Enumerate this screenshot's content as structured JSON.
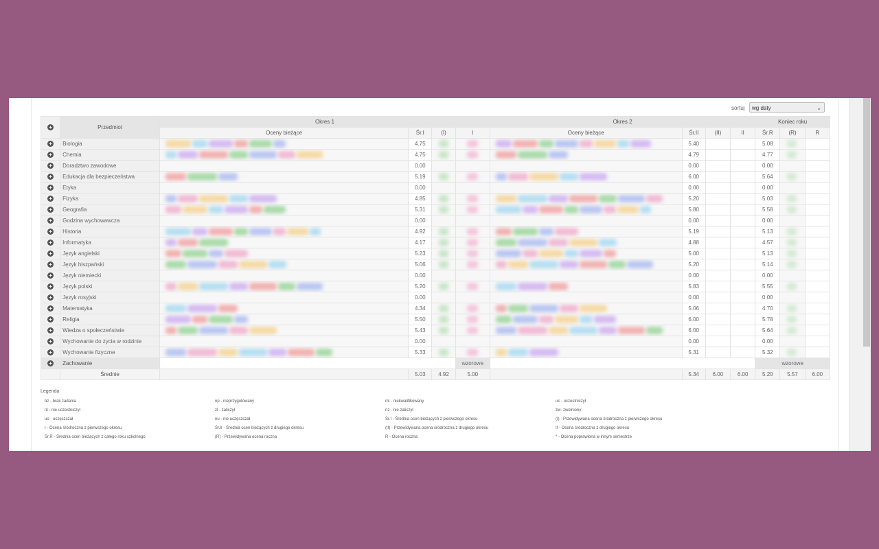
{
  "sort": {
    "label": "sortuj",
    "value": "wg daty"
  },
  "headers": {
    "subject": "Przedmiot",
    "period1": "Okres 1",
    "period2": "Okres 2",
    "year_end": "Koniec roku",
    "current1": "Oceny bieżące",
    "current2": "Oceny bieżące",
    "avg1": "Śr.I",
    "pred1": "(I)",
    "final1": "I",
    "avg2": "Śr.II",
    "pred2": "(II)",
    "final2": "II",
    "avgR": "Śr.R",
    "predR": "(R)",
    "finalR": "R"
  },
  "subjects": [
    {
      "name": "Biologia",
      "avg1": "4.75",
      "avg2": "5.40",
      "avgR": "5.08"
    },
    {
      "name": "Chemia",
      "avg1": "4.75",
      "avg2": "4.79",
      "avgR": "4.77"
    },
    {
      "name": "Doradztwo zawodowe",
      "avg1": "0.00",
      "avg2": "0.00",
      "avgR": "0.00"
    },
    {
      "name": "Edukacja dla bezpieczeństwa",
      "avg1": "5.19",
      "avg2": "6.00",
      "avgR": "5.64"
    },
    {
      "name": "Etyka",
      "avg1": "0.00",
      "avg2": "0.00",
      "avgR": "0.00"
    },
    {
      "name": "Fizyka",
      "avg1": "4.85",
      "avg2": "5.20",
      "avgR": "5.03"
    },
    {
      "name": "Geografia",
      "avg1": "5.31",
      "avg2": "5.80",
      "avgR": "5.58"
    },
    {
      "name": "Godzina wychowawcza",
      "avg1": "0.00",
      "avg2": "0.00",
      "avgR": "0.00"
    },
    {
      "name": "Historia",
      "avg1": "4.92",
      "avg2": "5.19",
      "avgR": "5.13"
    },
    {
      "name": "Informatyka",
      "avg1": "4.17",
      "avg2": "4.88",
      "avgR": "4.57"
    },
    {
      "name": "Język angielski",
      "avg1": "5.23",
      "avg2": "5.00",
      "avgR": "5.13"
    },
    {
      "name": "Język hiszpański",
      "avg1": "5.06",
      "avg2": "5.20",
      "avgR": "5.14"
    },
    {
      "name": "Język niemiecki",
      "avg1": "0.00",
      "avg2": "0.00",
      "avgR": "0.00"
    },
    {
      "name": "Język polski",
      "avg1": "5.20",
      "avg2": "5.83",
      "avgR": "5.55"
    },
    {
      "name": "Język rosyjski",
      "avg1": "0.00",
      "avg2": "0.00",
      "avgR": "0.00"
    },
    {
      "name": "Matematyka",
      "avg1": "4.34",
      "avg2": "5.06",
      "avgR": "4.70"
    },
    {
      "name": "Religia",
      "avg1": "5.50",
      "avg2": "6.00",
      "avgR": "5.78"
    },
    {
      "name": "Wiedza o społeczeństwie",
      "avg1": "5.43",
      "avg2": "6.00",
      "avgR": "5.64"
    },
    {
      "name": "Wychowanie do życia w rodzinie",
      "avg1": "0.00",
      "avg2": "0.00",
      "avgR": "0.00"
    },
    {
      "name": "Wychowanie fizyczne",
      "avg1": "5.33",
      "avg2": "5.31",
      "avgR": "5.32"
    }
  ],
  "behaviour": {
    "name": "Zachowanie",
    "period1": "wzorowe",
    "year_end": "wzorowe"
  },
  "averages": {
    "label": "Średnie",
    "avg1": "5.03",
    "pred1": "4.92",
    "final1": "5.00",
    "avg2": "5.34",
    "pred2": "6.00",
    "final2": "6.00",
    "avgR": "5.20",
    "predR": "5.57",
    "finalR": "6.00"
  },
  "legend": {
    "title": "Legenda",
    "items": [
      "bz - brak zadania",
      "np - nieprzygotowany",
      "nk - niekwalifikowany",
      "uc - uczestniczył",
      "nl - nie uczestniczył",
      "zl - zaliczył",
      "nz - nie zaliczył",
      "zw- zwolniony",
      "uo - uczęszczał",
      "nu - nie uczęszczał",
      "Śr.I - Średnia ocen bieżących z pierwszego okresu",
      "(I) - Przewidywana ocena śródroczna z pierwszego okresu",
      "I - Ocena śródroczna z pierwszego okresu",
      "Śr.II - Średnia ocen bieżących z drugiego okresu",
      "(II) - Przewidywana ocena śródroczna z drugiego okresu",
      "II - Ocena śródroczna z drugiego okresu",
      "Śr.R - Średnia ocen bieżących z całego roku szkolnego",
      "(R) - Przewidywana ocena roczna",
      "R - Ocena roczna",
      "* - Ocena poprawiona w innym semestrze"
    ]
  },
  "colors": {
    "background": "#96597f",
    "header": "#e5e5e5"
  }
}
